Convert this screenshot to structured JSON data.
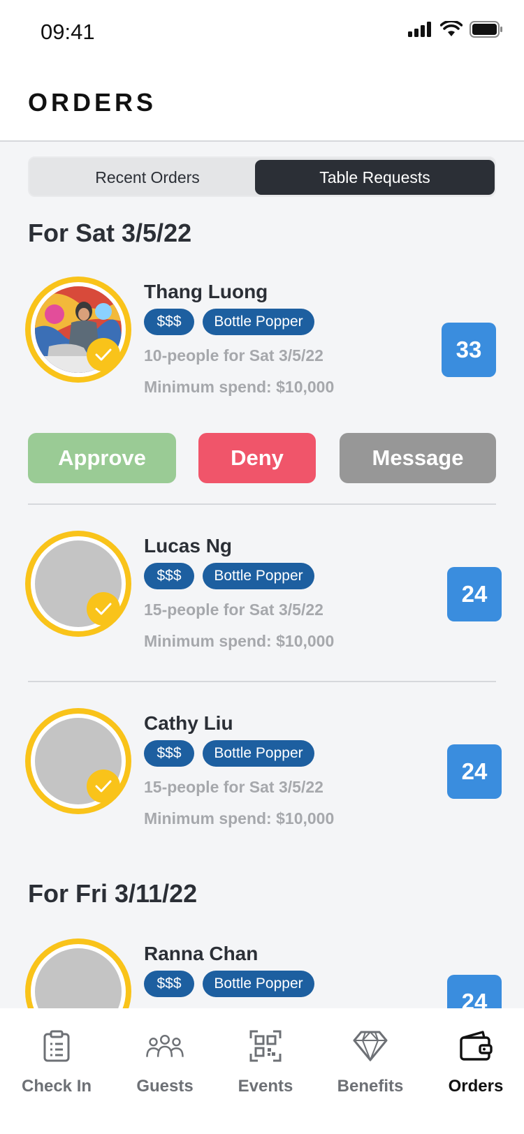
{
  "status_bar": {
    "time": "09:41"
  },
  "header": {
    "title": "ORDERS"
  },
  "segments": {
    "recent": "Recent Orders",
    "table_requests": "Table Requests",
    "selected": "Table Requests"
  },
  "groups": [
    {
      "date_label": "For Sat 3/5/22",
      "requests": [
        {
          "name": "Thang Luong",
          "price_tag": "$$$",
          "tier_tag": "Bottle Popper",
          "party": "10-people for Sat 3/5/22",
          "min_spend": "Minimum spend: $10,000",
          "count": "33",
          "actions": {
            "approve": "Approve",
            "deny": "Deny",
            "message": "Message"
          }
        },
        {
          "name": "Lucas Ng",
          "price_tag": "$$$",
          "tier_tag": "Bottle Popper",
          "party": "15-people for Sat 3/5/22",
          "min_spend": "Minimum spend: $10,000",
          "count": "24"
        },
        {
          "name": "Cathy Liu",
          "price_tag": "$$$",
          "tier_tag": "Bottle Popper",
          "party": "15-people for Sat 3/5/22",
          "min_spend": "Minimum spend: $10,000",
          "count": "24"
        }
      ]
    },
    {
      "date_label": "For Fri 3/11/22",
      "requests": [
        {
          "name": "Ranna Chan",
          "price_tag": "$$$",
          "tier_tag": "Bottle Popper",
          "count": "24"
        }
      ]
    }
  ],
  "tabbar": {
    "items": [
      {
        "label": "Check In",
        "icon": "clipboard-icon"
      },
      {
        "label": "Guests",
        "icon": "people-icon"
      },
      {
        "label": "Events",
        "icon": "qr-code-icon"
      },
      {
        "label": "Benefits",
        "icon": "diamond-icon"
      },
      {
        "label": "Orders",
        "icon": "wallet-icon"
      }
    ],
    "active": "Orders"
  },
  "colors": {
    "accent_dark": "#2b2f36",
    "tag_blue": "#1d5fa0",
    "count_blue": "#3a8dde",
    "approve": "#9acb95",
    "deny": "#f0556a",
    "message": "#979797",
    "ring_gold": "#f9c31a"
  }
}
